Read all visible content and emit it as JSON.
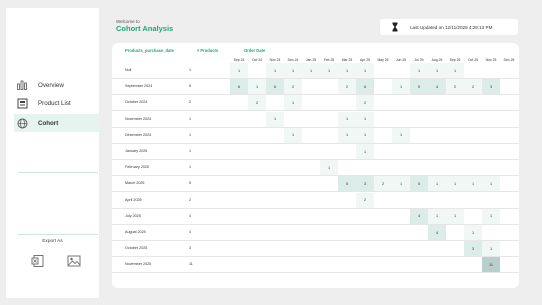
{
  "header": {
    "welcome": "Welcome to",
    "title": "Cohort Analysis",
    "last_updated": "Last Updated on 12/11/2025 4:29:13 PM"
  },
  "sidebar": {
    "items": [
      {
        "label": "Overview",
        "icon": "bar-chart-icon"
      },
      {
        "label": "Product List",
        "icon": "product-list-icon"
      },
      {
        "label": "Cohort",
        "icon": "network-globe-icon"
      }
    ],
    "export_label": "Export As",
    "export_icons": [
      "excel-export-icon",
      "image-export-icon"
    ]
  },
  "table": {
    "headers": {
      "purchase_date": "Products_purchase_date",
      "num_products": "# Products",
      "order_date": "Order Date"
    },
    "months": [
      "Sep 24",
      "Oct 24",
      "Nov 24",
      "Dec 24",
      "Jan 25",
      "Feb 25",
      "Mar 25",
      "Apr 25",
      "May 25",
      "Jun 25",
      "Jul 25",
      "Aug 25",
      "Sep 25",
      "Oct 25",
      "Nov 25",
      "Dec 25"
    ],
    "rows": [
      {
        "label": "Null",
        "count": "1",
        "cells": [
          "1",
          "",
          "1",
          "1",
          "1",
          "1",
          "1",
          "1",
          "",
          "",
          "1",
          "1",
          "1",
          "",
          "",
          ""
        ]
      },
      {
        "label": "September 2024",
        "count": "6",
        "cells": [
          "6",
          "1",
          "6",
          "2",
          "",
          "",
          "2",
          "6",
          "",
          "1",
          "5",
          "4",
          "2",
          "2",
          "3",
          ""
        ]
      },
      {
        "label": "October 2024",
        "count": "2",
        "cells": [
          "",
          "2",
          "",
          "1",
          "",
          "",
          "",
          "2",
          "",
          "",
          "",
          "",
          "",
          "",
          "",
          ""
        ]
      },
      {
        "label": "November 2024",
        "count": "1",
        "cells": [
          "",
          "",
          "1",
          "",
          "",
          "",
          "1",
          "1",
          "",
          "",
          "",
          "",
          "",
          "",
          "",
          ""
        ]
      },
      {
        "label": "December 2024",
        "count": "1",
        "cells": [
          "",
          "",
          "",
          "1",
          "",
          "",
          "1",
          "1",
          "",
          "1",
          "",
          "",
          "",
          "",
          "",
          ""
        ]
      },
      {
        "label": "January 2025",
        "count": "1",
        "cells": [
          "",
          "",
          "",
          "",
          "",
          "",
          "",
          "1",
          "",
          "",
          "",
          "",
          "",
          "",
          "",
          ""
        ]
      },
      {
        "label": "February 2025",
        "count": "1",
        "cells": [
          "",
          "",
          "",
          "",
          "",
          "1",
          "",
          "",
          "",
          "",
          "",
          "",
          "",
          "",
          "",
          ""
        ]
      },
      {
        "label": "March 2025",
        "count": "5",
        "cells": [
          "",
          "",
          "",
          "",
          "",
          "",
          "5",
          "3",
          "2",
          "1",
          "5",
          "1",
          "1",
          "1",
          "1",
          ""
        ]
      },
      {
        "label": "April 2025",
        "count": "2",
        "cells": [
          "",
          "",
          "",
          "",
          "",
          "",
          "",
          "2",
          "",
          "",
          "",
          "",
          "",
          "",
          "",
          ""
        ]
      },
      {
        "label": "July 2025",
        "count": "4",
        "cells": [
          "",
          "",
          "",
          "",
          "",
          "",
          "",
          "",
          "",
          "",
          "4",
          "1",
          "1",
          "",
          "1",
          ""
        ]
      },
      {
        "label": "August 2025",
        "count": "4",
        "cells": [
          "",
          "",
          "",
          "",
          "",
          "",
          "",
          "",
          "",
          "",
          "",
          "4",
          "",
          "1",
          "",
          ""
        ]
      },
      {
        "label": "October 2025",
        "count": "3",
        "cells": [
          "",
          "",
          "",
          "",
          "",
          "",
          "",
          "",
          "",
          "",
          "",
          "",
          "",
          "3",
          "1",
          ""
        ]
      },
      {
        "label": "November 2025",
        "count": "11",
        "cells": [
          "",
          "",
          "",
          "",
          "",
          "",
          "",
          "",
          "",
          "",
          "",
          "",
          "",
          "",
          "11",
          ""
        ]
      }
    ]
  },
  "colors": {
    "accent": "#1aa87a",
    "heat_low": "#f0f7f5",
    "heat_mid": "#dcece8",
    "heat_high": "#b9cfcb"
  }
}
